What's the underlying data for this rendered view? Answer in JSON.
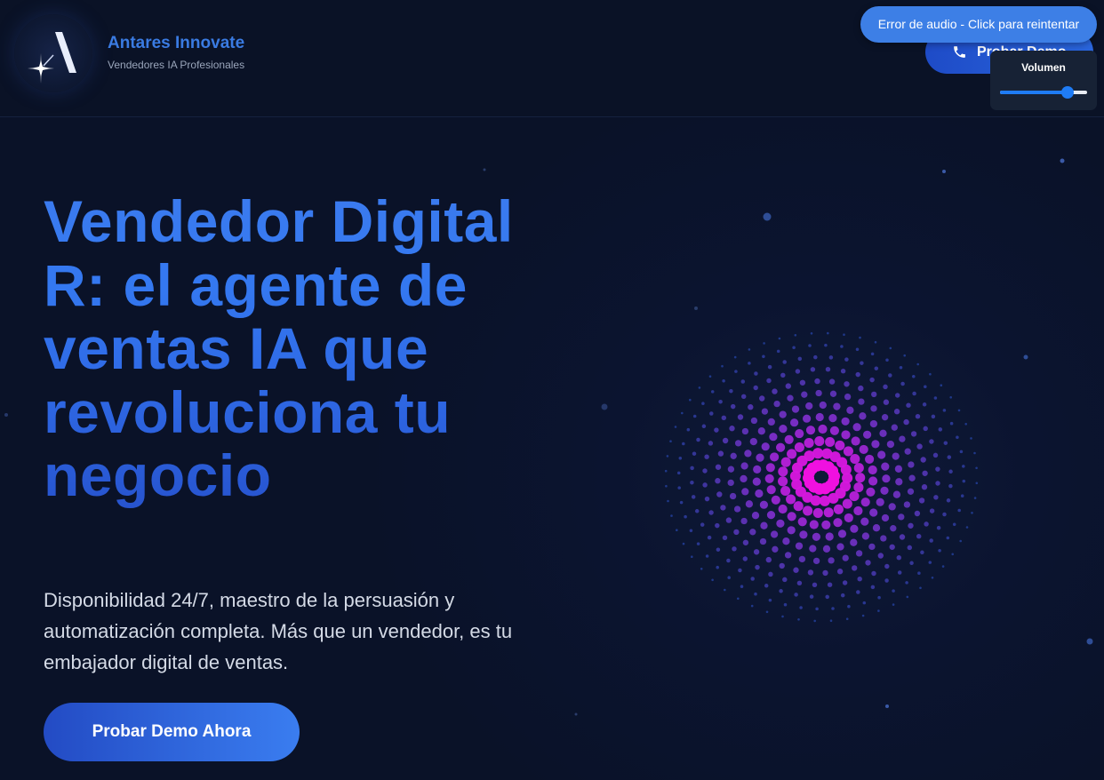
{
  "brand": {
    "name": "Antares Innovate",
    "tagline": "Vendedores IA Profesionales",
    "logo_letter": "A"
  },
  "header": {
    "demo_button_label": "Probar Demo",
    "phone_icon": "phone-icon"
  },
  "audio": {
    "error_text": "Error de audio - Click para reintentar",
    "volume_label": "Volumen",
    "volume_level": 0.78
  },
  "hero": {
    "title": "Vendedor Digital R: el agente de ventas IA que revoluciona tu negocio",
    "description": "Disponibilidad 24/7, maestro de la persuasión y automatización completa. Más que un vendedor, es tu embajador digital de ventas.",
    "cta_label": "Probar Demo Ahora"
  },
  "colors": {
    "background": "#0a1228",
    "accent": "#3478f0",
    "orb_core": "#f010e0",
    "orb_mid": "#8a2fd8",
    "orb_outer": "#2a4bb8"
  }
}
